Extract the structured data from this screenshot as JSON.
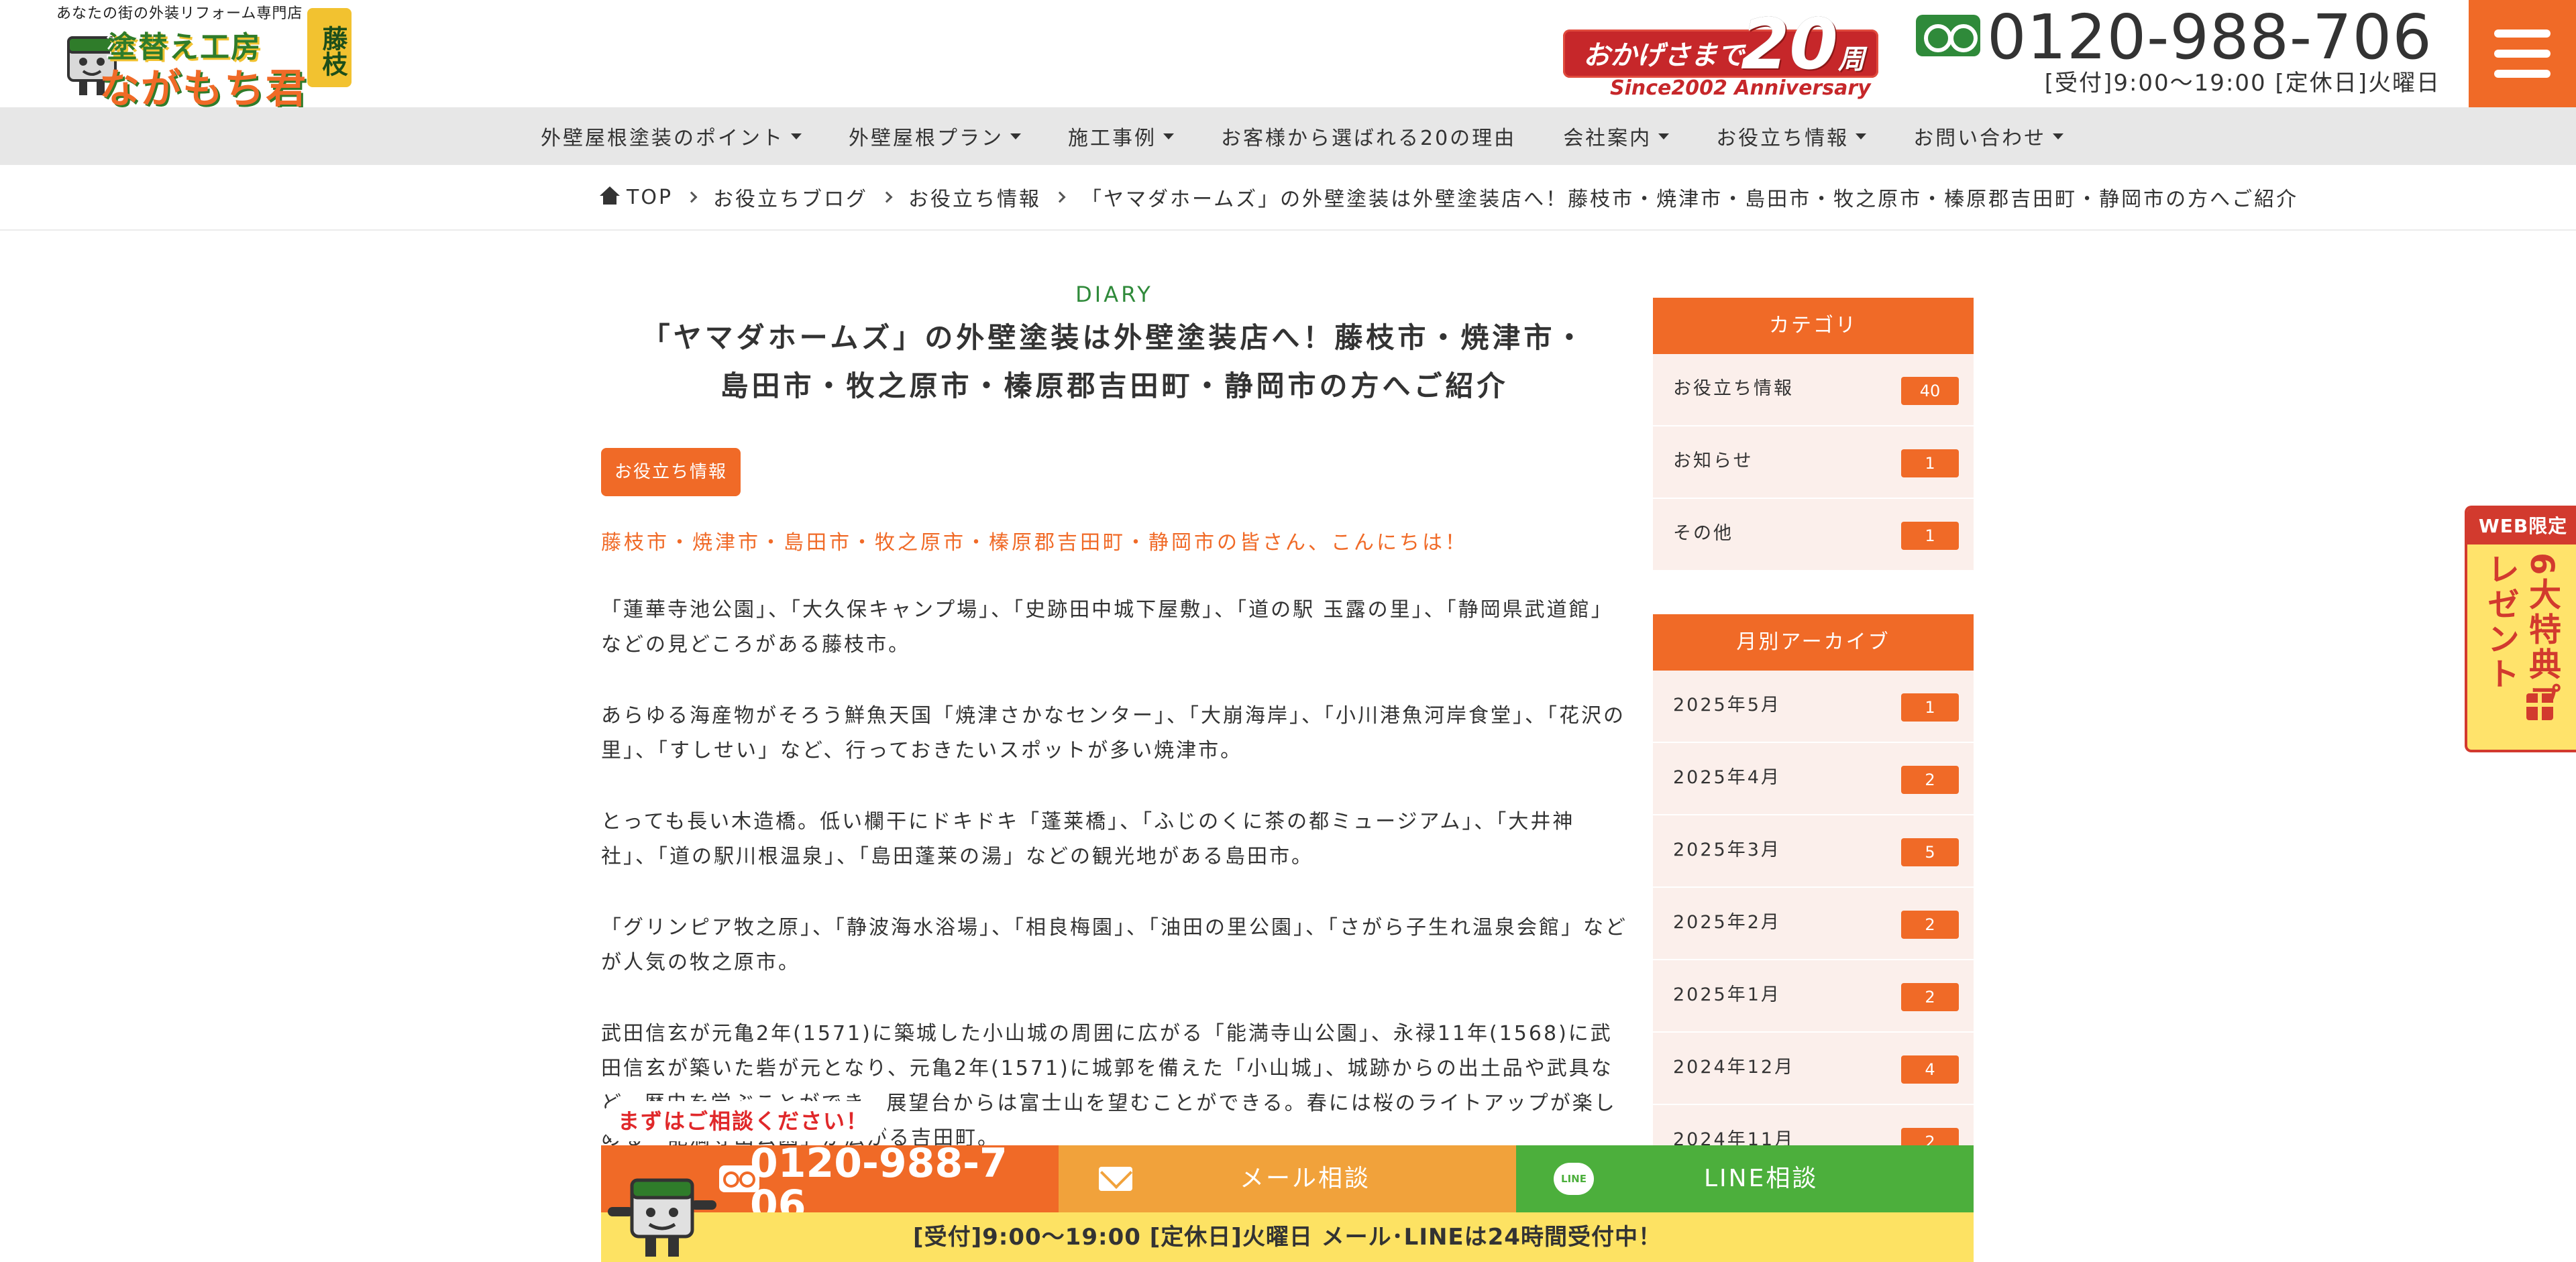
{
  "header": {
    "logo": {
      "tagline": "あなたの街の外装リフォーム専門店",
      "line1": "塗替え工房",
      "line2": "ながもち君",
      "badge": "藤枝"
    },
    "anniversary": {
      "main": "おかげさまで",
      "number": "20",
      "unit": "周年",
      "sub": "Since2002 Anniversary"
    },
    "phone": "0120-988-706",
    "hours": "[受付]9:00〜19:00 [定休日]火曜日"
  },
  "nav": {
    "items": [
      {
        "label": "外壁屋根塗装のポイント",
        "dropdown": true
      },
      {
        "label": "外壁屋根プラン",
        "dropdown": true
      },
      {
        "label": "施工事例",
        "dropdown": true
      },
      {
        "label": "お客様から選ばれる20の理由",
        "dropdown": false
      },
      {
        "label": "会社案内",
        "dropdown": true
      },
      {
        "label": "お役立ち情報",
        "dropdown": true
      },
      {
        "label": "お問い合わせ",
        "dropdown": true
      }
    ]
  },
  "breadcrumb": {
    "home": "TOP",
    "items": [
      "お役立ちブログ",
      "お役立ち情報"
    ],
    "current": "「ヤマダホームズ」の外壁塗装は外壁塗装店へ！藤枝市・焼津市・島田市・牧之原市・榛原郡吉田町・静岡市の方へご紹介"
  },
  "article": {
    "category_label": "DIARY",
    "title_line1": "「ヤマダホームズ」の外壁塗装は外壁塗装店へ！藤枝市・焼津市・",
    "title_line2": "島田市・牧之原市・榛原郡吉田町・静岡市の方へご紹介",
    "tag": "お役立ち情報",
    "lead": "藤枝市・焼津市・島田市・牧之原市・榛原郡吉田町・静岡市の皆さん、こんにちは！",
    "paragraphs": [
      "「蓮華寺池公園」、「大久保キャンプ場」、「史跡田中城下屋敷」、「道の駅 玉露の里」、「静岡県武道館」などの見どころがある藤枝市。",
      "あらゆる海産物がそろう鮮魚天国「焼津さかなセンター」、「大崩海岸」、「小川港魚河岸食堂」、「花沢の里」、「すしせい」など、行っておきたいスポットが多い焼津市。",
      "とっても長い木造橋。低い欄干にドキドキ「蓬莱橋」、「ふじのくに茶の都ミュージアム」、「大井神社」、「道の駅川根温泉」、「島田蓬莱の湯」などの観光地がある島田市。",
      "「グリンピア牧之原」、「静波海水浴場」、「相良梅園」、「油田の里公園」、「さがら子生れ温泉会館」などが人気の牧之原市。",
      "武田信玄が元亀2年(1571)に築城した小山城の周囲に広がる「能満寺山公園」、永禄11年(1568)に武田信玄が築いた砦が元となり、元亀2年(1571)に城郭を備えた「小山城」、城跡からの出土品や武具など、歴史を学ぶことができ、展望台からは富士山を望むことができる。春には桜のライトアップが楽しめる「能満寺山公園」が広がる吉田町。"
    ]
  },
  "sidebar": {
    "categories": {
      "title": "カテゴリ",
      "items": [
        {
          "label": "お役立ち情報",
          "count": "40"
        },
        {
          "label": "お知らせ",
          "count": "1"
        },
        {
          "label": "その他",
          "count": "1"
        }
      ]
    },
    "archive": {
      "title": "月別アーカイブ",
      "items": [
        {
          "label": "2025年5月",
          "count": "1"
        },
        {
          "label": "2025年4月",
          "count": "2"
        },
        {
          "label": "2025年3月",
          "count": "5"
        },
        {
          "label": "2025年2月",
          "count": "2"
        },
        {
          "label": "2025年1月",
          "count": "2"
        },
        {
          "label": "2024年12月",
          "count": "4"
        },
        {
          "label": "2024年11月",
          "count": "2"
        }
      ]
    }
  },
  "floating_tab": {
    "head": "WEB限定",
    "text": "6大特典プレゼント"
  },
  "cta": {
    "bubble": "まずはご相談ください！",
    "phone": "0120-988-706",
    "mail_label": "メール相談",
    "line_label": "LINE相談",
    "line_icon_text": "LINE",
    "hours": "[受付]9:00〜19:00 [定休日]火曜日 メール･LINEは24時間受付中！"
  },
  "colors": {
    "brand_orange": "#f06a27",
    "brand_green": "#2f8a3a",
    "line_green": "#4caf3c",
    "mail_orange": "#f1a23b",
    "cta_yellow": "#fde263",
    "sidebar_bg": "#fbefeb"
  }
}
